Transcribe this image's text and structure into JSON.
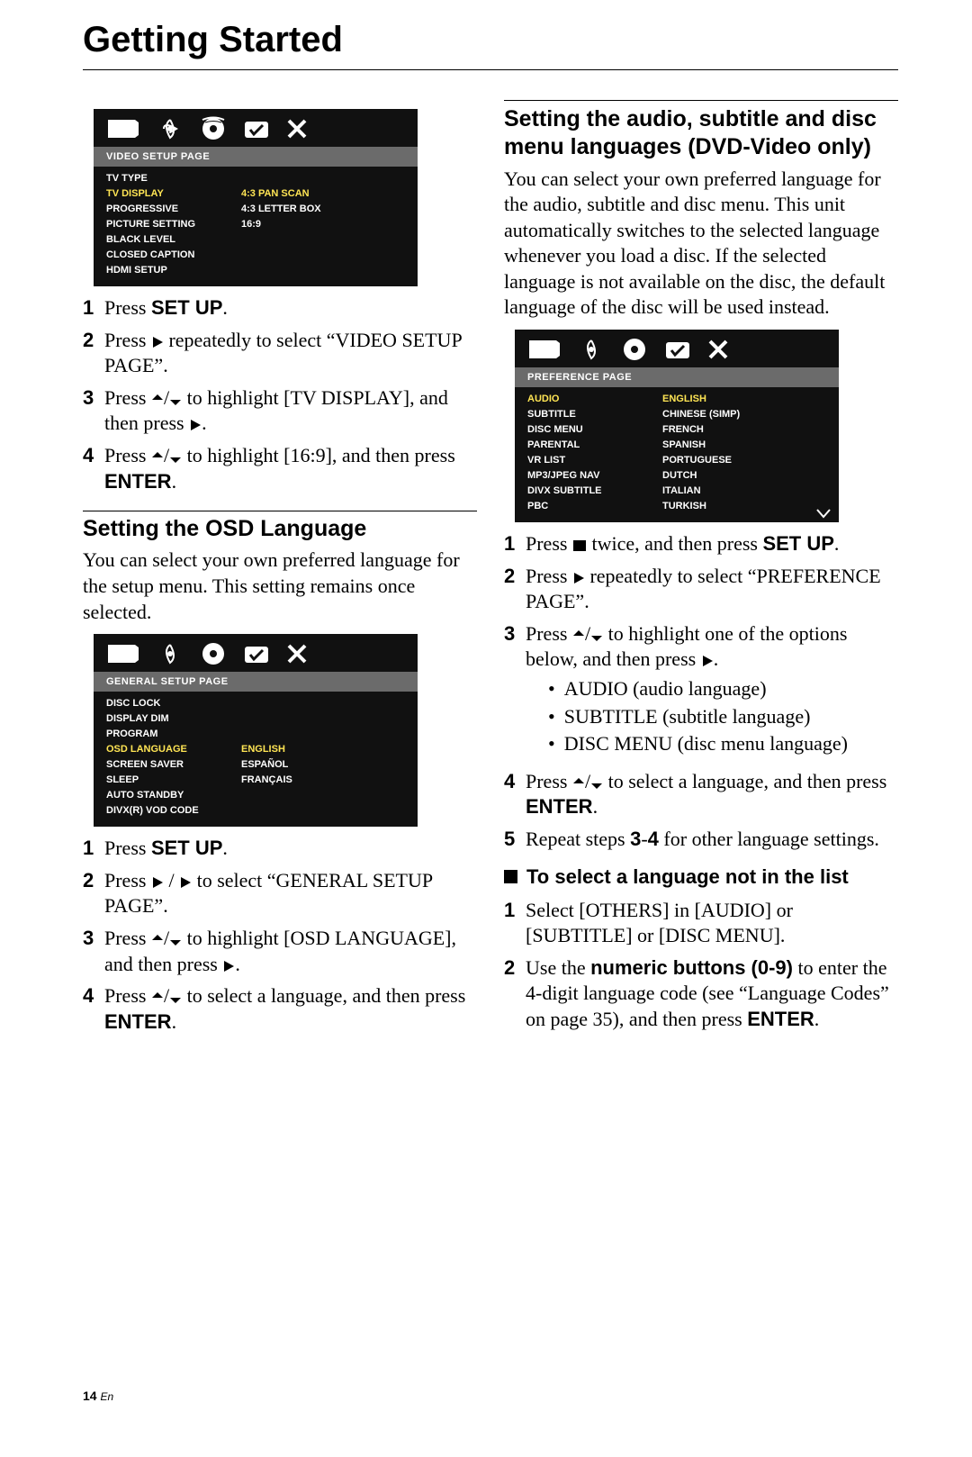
{
  "page": {
    "title": "Getting Started",
    "footer_num": "14",
    "footer_lang": "En"
  },
  "osd1": {
    "header": "VIDEO SETUP PAGE",
    "rows": [
      {
        "lab": "TV TYPE",
        "val": ""
      },
      {
        "lab": "TV DISPLAY",
        "val": "4:3 PAN SCAN",
        "hl": true
      },
      {
        "lab": "PROGRESSIVE",
        "val": "4:3 LETTER BOX"
      },
      {
        "lab": "PICTURE SETTING",
        "val": "16:9"
      },
      {
        "lab": "BLACK LEVEL",
        "val": ""
      },
      {
        "lab": "CLOSED CAPTION",
        "val": ""
      },
      {
        "lab": "HDMI SETUP",
        "val": ""
      }
    ]
  },
  "left_steps_a": [
    {
      "n": "1",
      "pre": "Press ",
      "b": "SET UP",
      "post": "."
    },
    {
      "n": "2",
      "text": "Press ▶ repeatedly to select “VIDEO SETUP PAGE”.",
      "glyph_play": true
    },
    {
      "n": "3",
      "text": "Press ▲/▼ to highlight [TV DISPLAY], and then press ▶.",
      "glyph_ud": true,
      "glyph_play_end": true
    },
    {
      "n": "4",
      "pre": "Press ▲/▼ to highlight [16:9], and then press ",
      "b": "ENTER",
      "post": ".",
      "glyph_ud": true
    }
  ],
  "left_sub": {
    "heading": "Setting the OSD Language",
    "para": "You can select your own preferred language for the setup menu. This setting remains once selected."
  },
  "osd2": {
    "header": "GENERAL SETUP PAGE",
    "rows": [
      {
        "lab": "DISC LOCK",
        "val": ""
      },
      {
        "lab": "DISPLAY DIM",
        "val": ""
      },
      {
        "lab": "PROGRAM",
        "val": ""
      },
      {
        "lab": "OSD LANGUAGE",
        "val": "ENGLISH",
        "hl": true
      },
      {
        "lab": "SCREEN SAVER",
        "val": "ESPAÑOL"
      },
      {
        "lab": "SLEEP",
        "val": "FRANÇAIS"
      },
      {
        "lab": "AUTO STANDBY",
        "val": ""
      },
      {
        "lab": "DIVX(R) VOD CODE",
        "val": ""
      }
    ]
  },
  "left_steps_b": [
    {
      "n": "1",
      "pre": "Press ",
      "b": "SET UP",
      "post": "."
    },
    {
      "n": "2",
      "text": "Press ◀ / ▶ to select “GENERAL SETUP PAGE”.",
      "glyph_lr": true
    },
    {
      "n": "3",
      "text": "Press ▲/▼ to highlight [OSD LANGUAGE], and then press ▶.",
      "glyph_ud": true,
      "glyph_play_end": true
    },
    {
      "n": "4",
      "pre": "Press ▲/▼ to select a language, and then press ",
      "b": "ENTER",
      "post": ".",
      "glyph_ud": true
    }
  ],
  "right_head": "Setting the audio, subtitle and disc menu languages (DVD-Video only)",
  "right_para": "You can select your own preferred language for the audio, subtitle and disc menu. This unit automatically switches to the selected language whenever you load a disc. If the selected language is not available on the disc, the default language of the disc will be used instead.",
  "osd3": {
    "header": "PREFERENCE PAGE",
    "rows": [
      {
        "lab": "AUDIO",
        "val": "ENGLISH",
        "hl": true
      },
      {
        "lab": "SUBTITLE",
        "val": "CHINESE (SIMP)"
      },
      {
        "lab": "DISC MENU",
        "val": "FRENCH"
      },
      {
        "lab": "PARENTAL",
        "val": "SPANISH"
      },
      {
        "lab": "VR LIST",
        "val": "PORTUGUESE"
      },
      {
        "lab": "MP3/JPEG NAV",
        "val": "DUTCH"
      },
      {
        "lab": "DIVX SUBTITLE",
        "val": "ITALIAN"
      },
      {
        "lab": "PBC",
        "val": "TURKISH"
      }
    ]
  },
  "right_steps": [
    {
      "n": "1",
      "text_pre": "Press ",
      "glyph_stop": true,
      "text_mid": " twice, and then press ",
      "b": "SET UP",
      "post": "."
    },
    {
      "n": "2",
      "text": "Press ▶ repeatedly to select “PREFERENCE PAGE”.",
      "glyph_play": true
    },
    {
      "n": "3",
      "text": "Press ▲/▼ to highlight one of the options below, and then press ▶.",
      "glyph_ud": true,
      "glyph_play_end": true,
      "bullets": [
        "AUDIO (audio language)",
        "SUBTITLE (subtitle language)",
        "DISC MENU (disc menu language)"
      ]
    },
    {
      "n": "4",
      "pre": "Press ▲/▼ to select a language, and then press ",
      "b": "ENTER",
      "post": ".",
      "glyph_ud": true
    },
    {
      "n": "5",
      "text_pre": "Repeat steps ",
      "b": "3",
      "mid": "-",
      "b2": "4",
      "post": " for other language settings."
    }
  ],
  "mini_sub": "To select a language not in the list",
  "right_steps_b": [
    {
      "n": "1",
      "text": "Select [OTHERS] in [AUDIO] or [SUBTITLE] or [DISC MENU]."
    },
    {
      "n": "2",
      "pre": "Use the ",
      "b": "numeric buttons (0-9)",
      "mid": " to enter the 4-digit language code (see “Language Codes” on page 35), and then press ",
      "b2": "ENTER",
      "post": "."
    }
  ]
}
